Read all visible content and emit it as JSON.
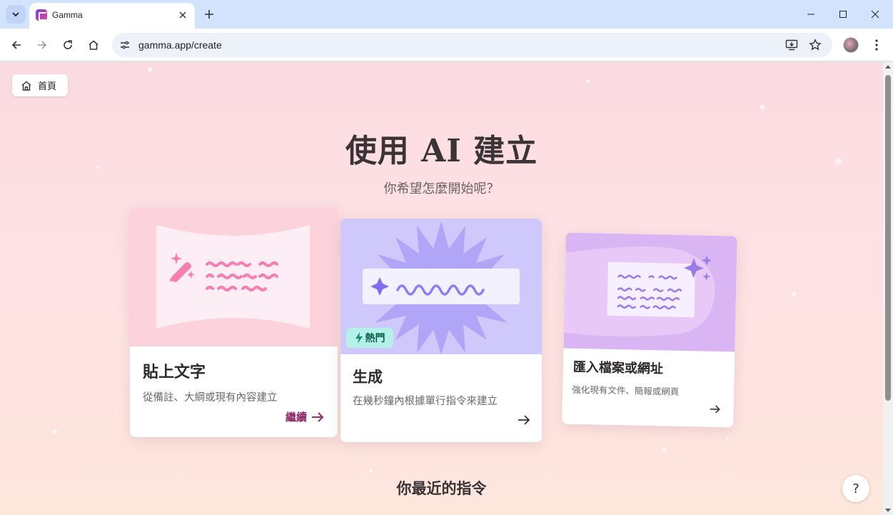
{
  "browser": {
    "tab_title": "Gamma",
    "url": "gamma.app/create"
  },
  "page": {
    "home_label": "首頁",
    "heading": "使用 AI 建立",
    "subheading": "你希望怎麼開始呢？",
    "cards": [
      {
        "title": "貼上文字",
        "description": "從備註、大綱或現有內容建立",
        "action": "繼續"
      },
      {
        "title": "生成",
        "description": "在幾秒鐘內根據單行指令來建立",
        "badge": "熱門"
      },
      {
        "title": "匯入檔案或網址",
        "description": "強化現有文件、簡報或網頁"
      }
    ],
    "recent_heading": "你最近的指令",
    "help_label": "?"
  },
  "colors": {
    "accent": "#8e2f6d",
    "hot_badge": "#b4f1e8",
    "card1_art": "#fcd3dc",
    "card2_art": "#cfc8fb",
    "card3_art": "#d9b6f3"
  }
}
